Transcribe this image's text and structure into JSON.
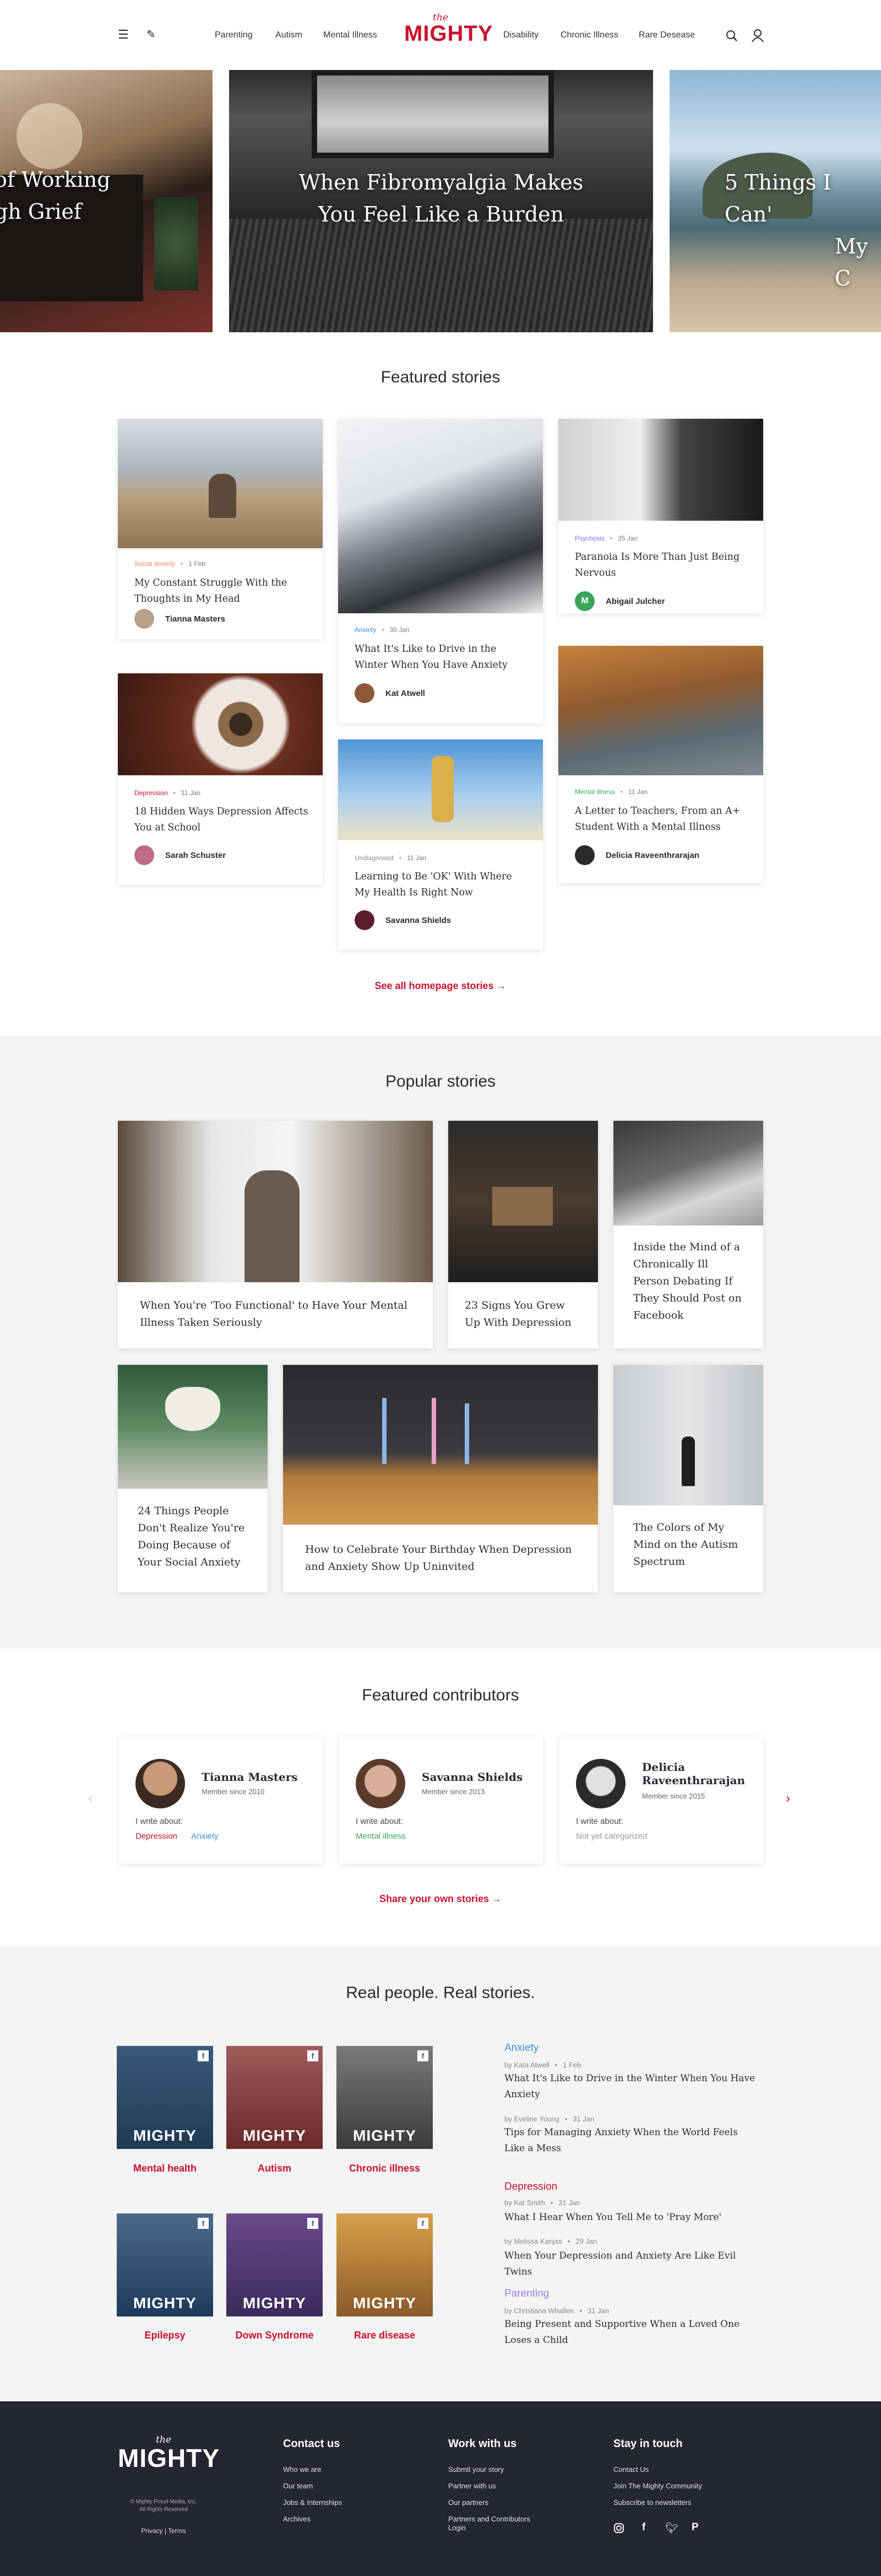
{
  "header": {
    "nav_left": [
      "Parenting",
      "Autism",
      "Mental Illness"
    ],
    "nav_right": [
      "Disability",
      "Chronic Illness",
      "Rare Desease"
    ],
    "logo_the": "the",
    "logo_name": "MIGHTY"
  },
  "hero": {
    "slides": [
      {
        "title_l1": "of Working",
        "title_l2": "gh Grief"
      },
      {
        "title_l1": "When Fibromyalgia Makes",
        "title_l2": "You Feel Like a Burden"
      },
      {
        "title_l1": "5 Things I Can'",
        "title_l2": "My C"
      }
    ]
  },
  "featured": {
    "title": "Featured stories",
    "cards": [
      {
        "category": "Social anxiety",
        "date": "1 Feb",
        "title": "My Constant Struggle With the Thoughts in My Head",
        "author": "Tianna Masters",
        "cat_color": "#f0845e"
      },
      {
        "category": "Depression",
        "date": "11 Jan",
        "title": "18 Hidden Ways Depression Affects You at School",
        "author": "Sarah Schuster",
        "cat_color": "#c8102e"
      },
      {
        "category": "Anxiety",
        "date": "30 Jan",
        "title": "What It's Like to Drive in the Winter When You Have Anxiety",
        "author": "Kat Atwell",
        "cat_color": "#3b8fd6"
      },
      {
        "category": "Undiagnosed",
        "date": "11 Jan",
        "title": "Learning to Be 'OK' With Where My Health Is Right Now",
        "author": "Savanna Shields",
        "cat_color": "#888888"
      },
      {
        "category": "Psychosis",
        "date": "25 Jan",
        "title": "Paranoia Is More Than Just Being Nervous",
        "author": "Abigail Julcher",
        "cat_color": "#7b6fd6"
      },
      {
        "category": "Mental illness",
        "date": "11 Jan",
        "title": "A Letter to Teachers, From an A+ Student With a Mental Illness",
        "author": "Delicia Raveenthrarajan",
        "cat_color": "#3aa55a"
      }
    ],
    "see_all": "See all homepage stories →"
  },
  "popular": {
    "title": "Popular stories",
    "items": [
      "When You're 'Too Functional' to Have Your Mental Illness Taken Seriously",
      "23 Signs You Grew Up With Depression",
      "Inside the Mind of a Chronically Ill Person Debating If They Should Post on Facebook",
      "24 Things People Don't Realize You're Doing Because of Your Social Anxiety",
      "How to Celebrate Your Birthday When Depression and Anxiety Show Up Uninvited",
      "The Colors of My Mind on the Autism Spectrum"
    ]
  },
  "contributors": {
    "title": "Featured contributors",
    "items": [
      {
        "name": "Tianna Masters",
        "since": "Member since 2010",
        "write_about": "I write about:",
        "tags": [
          "Depression",
          "Anxiety"
        ],
        "tag_colors": [
          "#c8102e",
          "#3b8fd6"
        ]
      },
      {
        "name": "Savanna Shields",
        "since": "Member since 2013",
        "write_about": "I write about:",
        "tags": [
          "Mental illness"
        ],
        "tag_colors": [
          "#3aa55a"
        ]
      },
      {
        "name": "Delicia Raveenthrarajan",
        "name_l1": "Delicia",
        "name_l2": "Raveenthrarajan",
        "since": "Member since 2015",
        "write_about": "I write about:",
        "tags": [
          "Not yet categorized"
        ],
        "tag_colors": [
          "#999999"
        ]
      }
    ],
    "share": "Share your own stories →"
  },
  "real": {
    "title": "Real people. Real stories.",
    "tiles": [
      "Mental health",
      "Autism",
      "Chronic illness",
      "Epilepsy",
      "Down Syndrome",
      "Rare disease"
    ],
    "tile_mark": "MIGHTY",
    "groups": [
      {
        "category": "Anxiety",
        "color": "#3b8fd6",
        "posts": [
          {
            "by": "by Kata Atwell",
            "date": "1 Feb",
            "title": "What It's Like to Drive in the Winter When You Have Anxiety"
          },
          {
            "by": "by Eveline Young",
            "date": "31 Jan",
            "title": "Tips for Managing Anxiety When the World Feels Like a Mess"
          }
        ]
      },
      {
        "category": "Depression",
        "color": "#c8102e",
        "posts": [
          {
            "by": "by Kat Smith",
            "date": "31 Jan",
            "title": "What I Hear When You Tell Me to 'Pray More'"
          },
          {
            "by": "by Melissa Kanjas",
            "date": "29 Jan",
            "title": "When Your Depression and Anxiety Are Like Evil Twins"
          }
        ]
      },
      {
        "category": "Parenting",
        "color": "#9a7fe0",
        "posts": [
          {
            "by": "by Christiana Whallen",
            "date": "31 Jan",
            "title": "Being Present and Supportive When a Loved One Loses a Child"
          }
        ]
      }
    ]
  },
  "footer": {
    "logo_the": "the",
    "logo_name": "MIGHTY",
    "copyright_l1": "© Mighty Proud Media, Inc.",
    "copyright_l2": "All Rights Reserved",
    "legal": "Privacy | Terms",
    "contact": {
      "title": "Contact us",
      "links": [
        "Who we are",
        "Our team",
        "Jobs & Internships",
        "Archives"
      ]
    },
    "work": {
      "title": "Work with us",
      "links": [
        "Submit your story",
        "Partner with us",
        "Our partners",
        "Partners and Contributors",
        "Login"
      ]
    },
    "touch": {
      "title": "Stay in touch",
      "links": [
        "Contact Us",
        "Join The Mighty Community",
        "Subscribe to newsletters"
      ]
    },
    "social": [
      "instagram-icon",
      "facebook-icon",
      "twitter-icon",
      "pinterest-icon"
    ]
  }
}
